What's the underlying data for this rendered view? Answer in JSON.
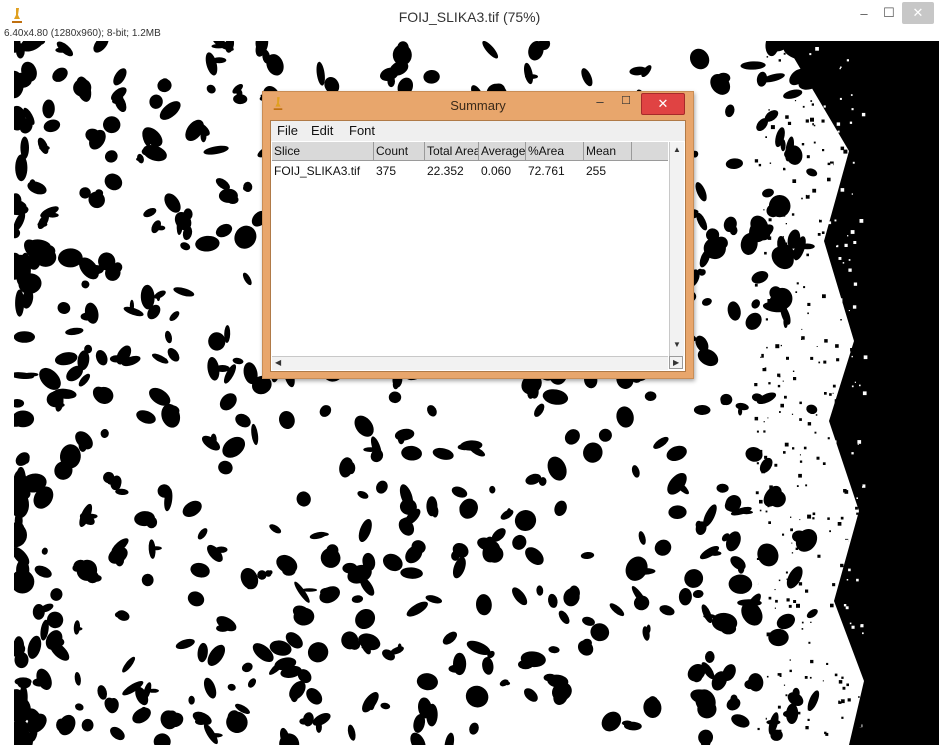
{
  "window": {
    "title": "FOIJ_SLIKA3.tif (75%)",
    "info": "6.40x4.80  (1280x960); 8-bit; 1.2MB",
    "controls": {
      "minimize": "–",
      "maximize": "☐",
      "close": "✕"
    }
  },
  "summary": {
    "title": "Summary",
    "controls": {
      "minimize": "–",
      "maximize": "☐",
      "close": "✕"
    },
    "menu": [
      "File",
      "Edit",
      "Font"
    ],
    "columns": [
      "Slice",
      "Count",
      "Total Area",
      "Average",
      "%Area",
      "Mean"
    ],
    "row": [
      "FOIJ_SLIKA3.tif",
      "375",
      "22.352",
      "0.060",
      "72.761",
      "255"
    ]
  },
  "colors": {
    "dialog_border": "#e8a66c",
    "close_button": "#e04343",
    "image_background": "#ffffff",
    "particles": "#000000"
  }
}
